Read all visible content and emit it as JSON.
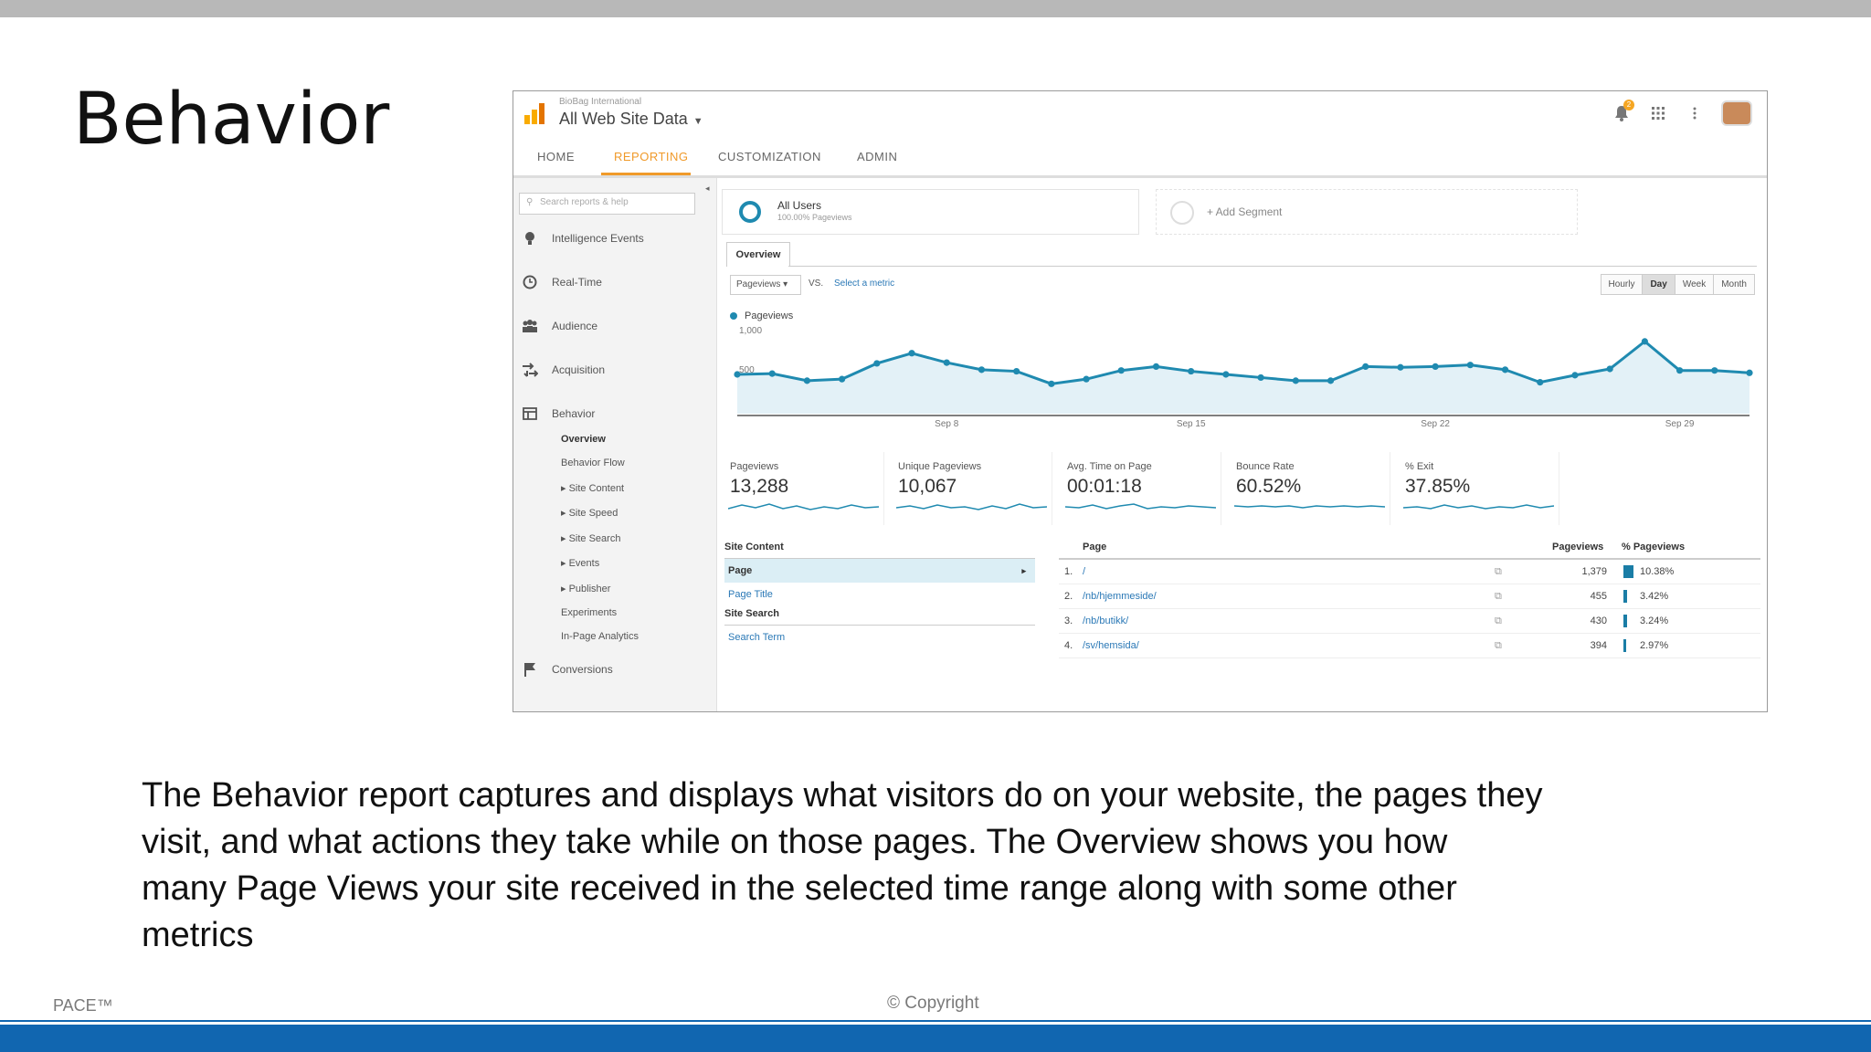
{
  "slide": {
    "title": "Behavior",
    "description": [
      "The Behavior report captures and displays what visitors do on your website, the pages they",
      "visit, and  what actions they take while on those pages. The Overview shows you how",
      "many Page Views your site  received in the selected time range along with some other",
      "metrics"
    ],
    "footer_left": "PACE™",
    "footer_center": "© Copyright",
    "colors": {
      "top_bar": "#b8b8b8",
      "bottom_bar": "#1166b0"
    }
  },
  "ga": {
    "account_small": "BioBag International",
    "account_main": "All Web Site Data",
    "header_icons": [
      {
        "icon": "bell-icon",
        "badge": "2"
      },
      {
        "icon": "apps-grid-icon"
      },
      {
        "icon": "more-vert-icon"
      },
      {
        "icon": "avatar"
      }
    ],
    "nav": [
      "HOME",
      "REPORTING",
      "CUSTOMIZATION",
      "ADMIN"
    ],
    "nav_active": "REPORTING",
    "accent": "#f09a2a",
    "sidebar": {
      "search_placeholder": "Search reports & help",
      "items": [
        {
          "label": "Intelligence Events",
          "icon": "lightbulb-icon"
        },
        {
          "label": "Real-Time",
          "icon": "clock-icon"
        },
        {
          "label": "Audience",
          "icon": "people-icon"
        },
        {
          "label": "Acquisition",
          "icon": "arrows-icon"
        },
        {
          "label": "Behavior",
          "icon": "behavior-icon"
        }
      ],
      "behavior_subitems": [
        "Overview",
        "Behavior Flow",
        "▸ Site Content",
        "▸ Site Speed",
        "▸ Site Search",
        "▸ Events",
        "▸ Publisher",
        "Experiments",
        "In-Page Analytics"
      ],
      "conversions": {
        "label": "Conversions",
        "icon": "flag-icon"
      }
    },
    "segments": {
      "active_name": "All Users",
      "active_sub": "100.00% Pageviews",
      "add_label": "+ Add Segment"
    },
    "overview_tab": "Overview",
    "metric_select": "Pageviews",
    "vs_label": "VS.",
    "select_metric": "Select a metric",
    "time_buttons": [
      "Hourly",
      "Day",
      "Week",
      "Month"
    ],
    "time_active": "Day",
    "chart_color": "#1f8ab0",
    "scorecards": [
      {
        "label": "Pageviews",
        "value": "13,288"
      },
      {
        "label": "Unique Pageviews",
        "value": "10,067"
      },
      {
        "label": "Avg. Time on Page",
        "value": "00:01:18"
      },
      {
        "label": "Bounce Rate",
        "value": "60.52%"
      },
      {
        "label": "% Exit",
        "value": "37.85%"
      }
    ],
    "left_table": {
      "site_content_header": "Site Content",
      "site_content_rows": [
        "Page",
        "Page Title"
      ],
      "site_search_header": "Site Search",
      "site_search_rows": [
        "Search Term"
      ]
    },
    "right_table": {
      "headers": {
        "page": "Page",
        "pageviews": "Pageviews",
        "pct": "% Pageviews"
      },
      "rows": [
        {
          "rank": "1.",
          "page": "/",
          "pageviews": "1,379",
          "pct": "10.38%",
          "pct_value": 10.38
        },
        {
          "rank": "2.",
          "page": "/nb/hjemmeside/",
          "pageviews": "455",
          "pct": "3.42%",
          "pct_value": 3.42
        },
        {
          "rank": "3.",
          "page": "/nb/butikk/",
          "pageviews": "430",
          "pct": "3.24%",
          "pct_value": 3.24
        },
        {
          "rank": "4.",
          "page": "/sv/hemsida/",
          "pageviews": "394",
          "pct": "2.97%",
          "pct_value": 2.97
        }
      ]
    }
  },
  "chart_data": {
    "type": "area",
    "series": [
      {
        "name": "Pageviews",
        "values": [
          500,
          510,
          420,
          440,
          640,
          770,
          650,
          560,
          540,
          380,
          440,
          550,
          600,
          540,
          500,
          460,
          420,
          420,
          600,
          590,
          600,
          620,
          560,
          400,
          490,
          570,
          920,
          550,
          550,
          520
        ]
      }
    ],
    "x_ticks": [
      {
        "index": 6,
        "label": "Sep 8"
      },
      {
        "index": 13,
        "label": "Sep 15"
      },
      {
        "index": 20,
        "label": "Sep 22"
      },
      {
        "index": 27,
        "label": "Sep 29"
      }
    ],
    "y_ticks": [
      {
        "value": 1000,
        "label": "1,000"
      },
      {
        "value": 500,
        "label": "500"
      }
    ],
    "ylim": [
      0,
      1000
    ]
  }
}
